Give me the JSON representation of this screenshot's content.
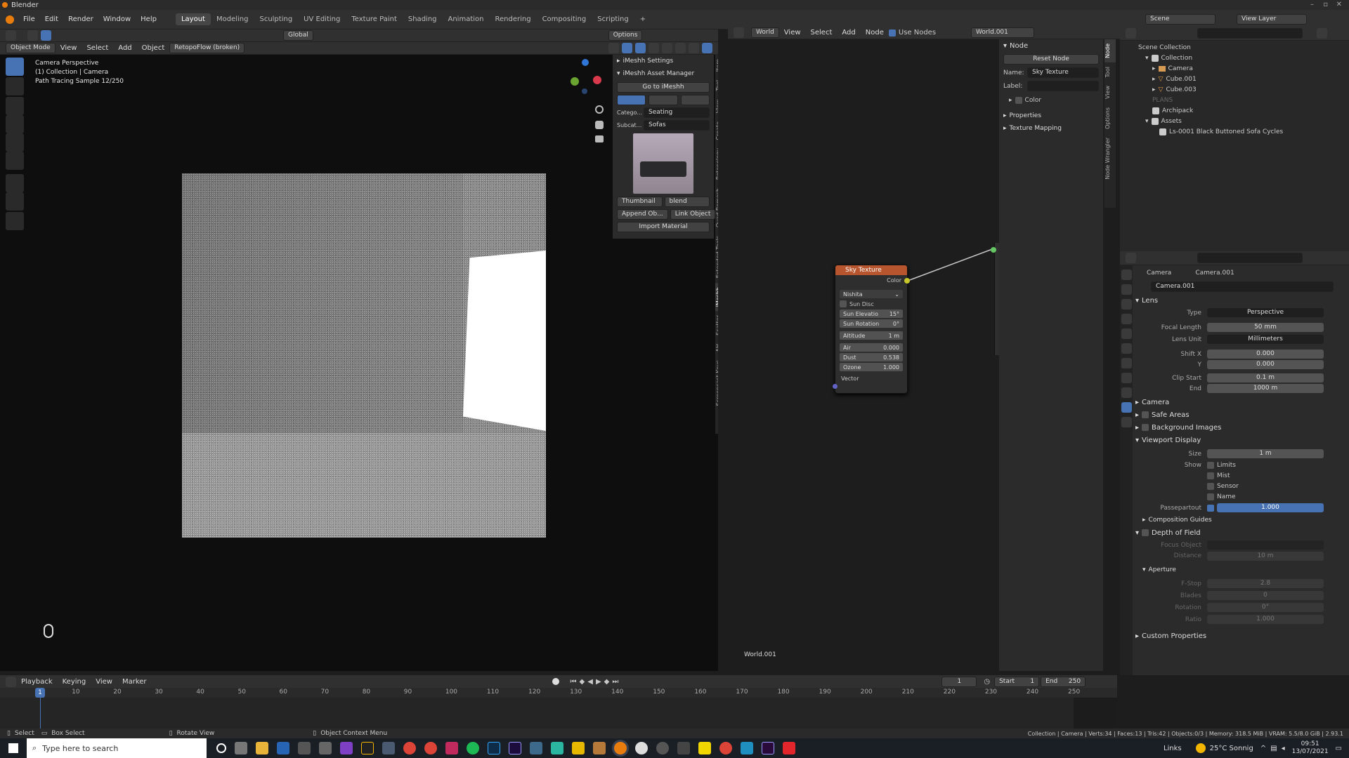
{
  "app": {
    "title": "Blender"
  },
  "menus": [
    "File",
    "Edit",
    "Render",
    "Window",
    "Help"
  ],
  "workspaces": [
    "Layout",
    "Modeling",
    "Sculpting",
    "UV Editing",
    "Texture Paint",
    "Shading",
    "Animation",
    "Rendering",
    "Compositing",
    "Scripting"
  ],
  "active_workspace": "Layout",
  "scene": {
    "name": "Scene",
    "view_layer": "View Layer"
  },
  "viewport": {
    "mode": "Object Mode",
    "view": "View",
    "select": "Select",
    "add": "Add",
    "object": "Object",
    "addon": "RetopoFlow (broken)",
    "transform": "Global",
    "options": "Options",
    "overlay": [
      "Camera Perspective",
      "(1) Collection | Camera",
      "Path Tracing Sample 12/250"
    ]
  },
  "imeshh": {
    "settings": "iMeshh Settings",
    "asset_manager": "iMeshh Asset Manager",
    "go": "Go to iMeshh",
    "category_label": "Catego...",
    "category": "Seating",
    "subcat_label": "Subcat...",
    "subcat": "Sofas",
    "thumbnail": "Thumbnail",
    "blend": "blend",
    "append": "Append Ob...",
    "link": "Link Object",
    "import": "Import Material"
  },
  "viewport_tabs": [
    "Item",
    "Tool",
    "View",
    "Create",
    "Retopology",
    "Quad Remesh",
    "Extended Tools",
    "iMeshh",
    "Scatter",
    "AH",
    "Screencast Keys"
  ],
  "node_editor": {
    "world_label": "World",
    "view": "View",
    "select": "Select",
    "add": "Add",
    "node": "Node",
    "use_nodes": "Use Nodes",
    "world_name": "World.001",
    "footer": "World.001"
  },
  "sky_node": {
    "title": "Sky Texture",
    "output": "Color",
    "type": "Nishita",
    "sun_disc": "Sun Disc",
    "fields": [
      {
        "label": "Sun Elevatio",
        "value": "15°"
      },
      {
        "label": "Sun Rotation",
        "value": "0°"
      },
      {
        "label": "Altitude",
        "value": "1 m"
      },
      {
        "label": "Air",
        "value": "0.000"
      },
      {
        "label": "Dust",
        "value": "0.538"
      },
      {
        "label": "Ozone",
        "value": "1.000"
      }
    ],
    "input": "Vector"
  },
  "node_panel": {
    "header": "Node",
    "reset": "Reset Node",
    "name_label": "Name:",
    "name": "Sky Texture",
    "label_label": "Label:",
    "color": "Color",
    "properties": "Properties",
    "texture_mapping": "Texture Mapping"
  },
  "node_tabs": [
    "Node",
    "Tool",
    "View",
    "Options",
    "Node Wrangler"
  ],
  "outliner": {
    "rows": [
      "Scene Collection",
      "Collection",
      "Camera",
      "Cube.001",
      "Cube.003",
      "PLANS",
      "Archipack",
      "Assets",
      "Ls-0001 Black Buttoned Sofa Cycles"
    ]
  },
  "properties": {
    "object": "Camera",
    "data": "Camera.001",
    "datablock": "Camera.001",
    "lens": "Lens",
    "type_label": "Type",
    "type": "Perspective",
    "focal_label": "Focal Length",
    "focal": "50 mm",
    "unit_label": "Lens Unit",
    "unit": "Millimeters",
    "shiftx_label": "Shift X",
    "shiftx": "0.000",
    "y_label": "Y",
    "y": "0.000",
    "clipstart_label": "Clip Start",
    "clipstart": "0.1 m",
    "end_label": "End",
    "end": "1000 m",
    "camera": "Camera",
    "safe_areas": "Safe Areas",
    "background_images": "Background Images",
    "viewport_display": "Viewport Display",
    "size_label": "Size",
    "size": "1 m",
    "show_label": "Show",
    "limits": "Limits",
    "mist": "Mist",
    "sensor": "Sensor",
    "name": "Name",
    "passepartout_label": "Passepartout",
    "passepartout": "1.000",
    "composition": "Composition Guides",
    "dof": "Depth of Field",
    "focus_label": "Focus Object",
    "distance_label": "Distance",
    "distance": "10 m",
    "aperture": "Aperture",
    "fstop_label": "F-Stop",
    "fstop": "2.8",
    "blades_label": "Blades",
    "blades": "0",
    "rotation_label": "Rotation",
    "rotation": "0°",
    "ratio_label": "Ratio",
    "ratio": "1.000",
    "custom": "Custom Properties"
  },
  "timeline": {
    "playback": "Playback",
    "keying": "Keying",
    "view": "View",
    "marker": "Marker",
    "frame": "1",
    "start_label": "Start",
    "start": "1",
    "end_label": "End",
    "end": "250",
    "ticks": [
      "10",
      "20",
      "30",
      "40",
      "50",
      "60",
      "70",
      "80",
      "90",
      "100",
      "110",
      "120",
      "130",
      "140",
      "150",
      "160",
      "170",
      "180",
      "190",
      "200",
      "210",
      "220",
      "230",
      "240",
      "250"
    ],
    "current": "1"
  },
  "status": {
    "select": "Select",
    "box_select": "Box Select",
    "rotate": "Rotate View",
    "context": "Object Context Menu",
    "stats": "Collection | Camera | Verts:34 | Faces:13 | Tris:42 | Objects:0/3 | Memory: 318.5 MiB | VRAM: 5.5/8.0 GiB | 2.93.1"
  },
  "taskbar": {
    "search": "Type here to search",
    "links": "Links",
    "weather": "25°C  Sonnig",
    "time": "09:51",
    "date": "13/07/2021"
  },
  "colors": {
    "accent": "#4772b3",
    "node_header": "#b7562e",
    "socket_yellow": "#c7c729"
  }
}
